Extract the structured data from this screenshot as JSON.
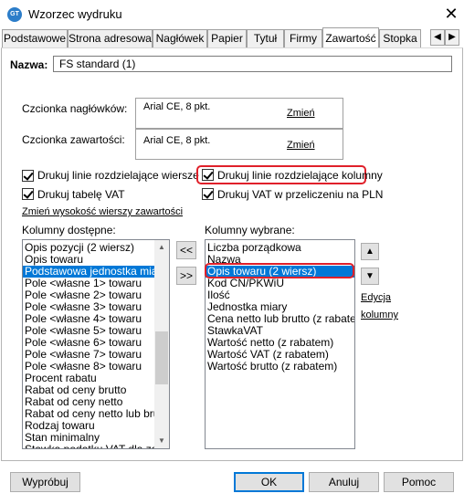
{
  "window": {
    "title": "Wzorzec wydruku",
    "icon_text": "GT"
  },
  "tabs": [
    "Podstawowe",
    "Strona adresowa",
    "Nagłówek",
    "Papier",
    "Tytuł",
    "Firmy",
    "Zawartość",
    "Stopka"
  ],
  "active_tab": "Zawartość",
  "name_field": {
    "label": "Nazwa:",
    "value": "FS standard (1)"
  },
  "header_font": {
    "label": "Czcionka nagłówków:",
    "value": "Arial CE, 8 pkt.",
    "link": "Zmień"
  },
  "content_font": {
    "label": "Czcionka zawartości:",
    "value": "Arial CE, 8 pkt.",
    "link": "Zmień"
  },
  "checkboxes": {
    "row_lines": {
      "label": "Drukuj linie rozdzielające wiersze",
      "checked": true
    },
    "col_lines": {
      "label": "Drukuj linie rozdzielające kolumny",
      "checked": true
    },
    "vat_table": {
      "label": "Drukuj tabelę VAT",
      "checked": true
    },
    "vat_pln": {
      "label": "Drukuj VAT w przeliczeniu na PLN",
      "checked": true
    }
  },
  "row_height_link": "Zmień wysokość wierszy zawartości",
  "available": {
    "label": "Kolumny dostępne:",
    "items": [
      "Opis pozycji (2 wiersz)",
      "Opis towaru",
      "Podstawowa jednostka miary",
      "Pole <własne 1> towaru",
      "Pole <własne 2> towaru",
      "Pole <własne 3> towaru",
      "Pole <własne 4> towaru",
      "Pole <własne 5> towaru",
      "Pole <własne 6> towaru",
      "Pole <własne 7> towaru",
      "Pole <własne 8> towaru",
      "Procent rabatu",
      "Rabat od ceny brutto",
      "Rabat od ceny netto",
      "Rabat od ceny netto lub brutto",
      "Rodzaj towaru",
      "Stan minimalny",
      "Stawka podatku VAT dla zaku"
    ],
    "selected_index": 2
  },
  "selected": {
    "label": "Kolumny wybrane:",
    "items": [
      "Liczba porządkowa",
      "Nazwa",
      "Opis towaru (2 wiersz)",
      "Kod CN/PKWiU",
      "Ilość",
      "Jednostka miary",
      "Cena netto lub brutto (z rabatem",
      "StawkaVAT",
      "Wartość netto (z rabatem)",
      "Wartość VAT (z rabatem)",
      "Wartość brutto (z rabatem)"
    ],
    "selected_index": 2
  },
  "transfer": {
    "remove": "<<",
    "add": ">>"
  },
  "edit_columns_link": [
    "Edycja",
    "kolumny"
  ],
  "footer": {
    "preview": "Wypróbuj",
    "ok": "OK",
    "cancel": "Anuluj",
    "help": "Pomoc"
  },
  "colors": {
    "selection": "#0078d7",
    "highlight_outline": "#e0202a"
  }
}
